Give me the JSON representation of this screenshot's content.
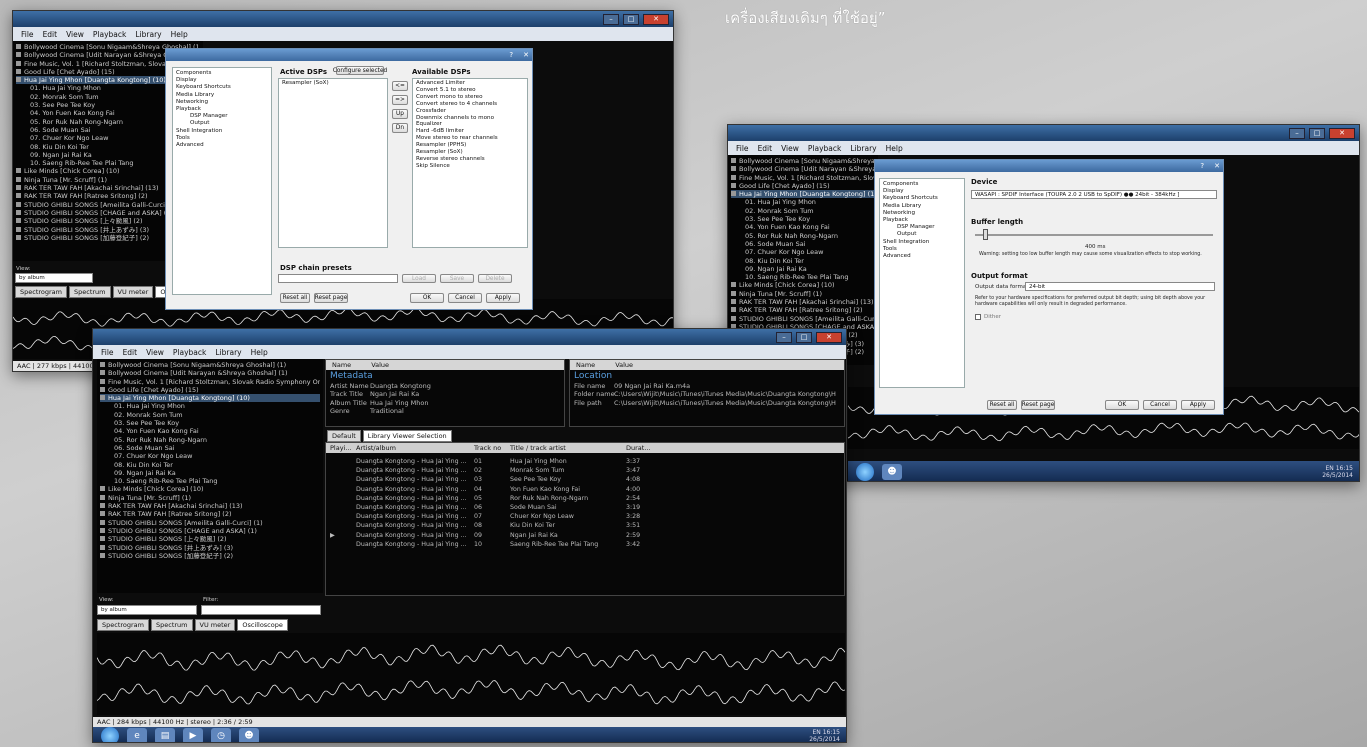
{
  "caption": "เครื่องเสียงเดิมๆ ที่ใช้อยู่”",
  "menu": [
    "File",
    "Edit",
    "View",
    "Playback",
    "Library",
    "Help"
  ],
  "library_tree": [
    {
      "label": "Bollywood Cinema [Sonu Nigaam&Shreya Ghoshal] (1)",
      "level": 0
    },
    {
      "label": "Bollywood Cinema [Udit Narayan &Shreya Ghoshal] (1)",
      "level": 0
    },
    {
      "label": "Fine Music, Vol. 1 [Richard Stoltzman, Slovak Radio Symphony Orche",
      "level": 0
    },
    {
      "label": "Good Life [Chet Ayado] (15)",
      "level": 0
    },
    {
      "label": "Hua Jai Ying Mhon [Duangta Kongtong] (10)",
      "level": 0,
      "selected": true
    },
    {
      "label": "01. Hua Jai Ying Mhon",
      "level": 1
    },
    {
      "label": "02. Monrak Som Tum",
      "level": 1
    },
    {
      "label": "03. See Pee Tee Koy",
      "level": 1
    },
    {
      "label": "04. Yon Fuen Kao Kong Fai",
      "level": 1
    },
    {
      "label": "05. Ror Ruk Nah Rong-Ngarn",
      "level": 1
    },
    {
      "label": "06. Sode Muan Sai",
      "level": 1
    },
    {
      "label": "07. Chuer Kor Ngo Leaw",
      "level": 1
    },
    {
      "label": "08. Kiu Din Koi Ter",
      "level": 1
    },
    {
      "label": "09. Ngan Jai Rai Ka",
      "level": 1
    },
    {
      "label": "10. Saeng Rib-Ree Tee Plai Tang",
      "level": 1
    },
    {
      "label": "Like Minds [Chick Corea] (10)",
      "level": 0
    },
    {
      "label": "Ninja Tuna [Mr. Scruff] (1)",
      "level": 0
    },
    {
      "label": "RAK TER TAW FAH [Akachai Srinchai] (13)",
      "level": 0
    },
    {
      "label": "RAK TER TAW FAH [Ratree Sritong] (2)",
      "level": 0
    },
    {
      "label": "STUDIO GHIBLI SONGS [Ameilita Galli-Curci] (1)",
      "level": 0
    },
    {
      "label": "STUDIO GHIBLI SONGS [CHAGE and ASKA] (1)",
      "level": 0
    },
    {
      "label": "STUDIO GHIBLI SONGS [上々颱風] (2)",
      "level": 0
    },
    {
      "label": "STUDIO GHIBLI SONGS [井上あずみ] (3)",
      "level": 0
    },
    {
      "label": "STUDIO GHIBLI SONGS [加藤登紀子] (2)",
      "level": 0
    }
  ],
  "view": {
    "label": "View:",
    "filter_label": "Filter:",
    "selected": "by album"
  },
  "vis_tabs": [
    {
      "label": "Spectrogram",
      "active": false
    },
    {
      "label": "Spectrum",
      "active": false
    },
    {
      "label": "VU meter",
      "active": false
    },
    {
      "label": "Oscilloscope",
      "active": true
    }
  ],
  "props_header": {
    "name": "Name",
    "value": "Value"
  },
  "metadata": {
    "heading": "Metadata",
    "rows": [
      [
        "Artist Name",
        "Duangta Kongtong"
      ],
      [
        "Track Title",
        "Ngan Jai Rai Ka"
      ],
      [
        "Album Title",
        "Hua Jai Ying Mhon"
      ],
      [
        "Genre",
        "Traditional"
      ]
    ]
  },
  "location": {
    "heading": "Location",
    "rows": [
      [
        "File name",
        "09 Ngan Jai Rai Ka.m4a"
      ],
      [
        "Folder name",
        "C:\\Users\\Wijit\\Music\\iTunes\\iTunes Media\\Music\\Duangta Kongtong\\H"
      ],
      [
        "File path",
        "C:\\Users\\Wijit\\Music\\iTunes\\iTunes Media\\Music\\Duangta Kongtong\\H"
      ]
    ]
  },
  "playlist_tabs": [
    {
      "label": "Default",
      "active": false
    },
    {
      "label": "Library Viewer Selection",
      "active": true
    }
  ],
  "playlist_cols": [
    "Playi...",
    "Artist/album",
    "Track no",
    "Title / track artist",
    "Durat..."
  ],
  "playlist_rows": [
    {
      "artist": "Duangta Kongtong - Hua Jai Ying ...",
      "no": "01",
      "title": "Hua Jai Ying Mhon",
      "dur": "3:37",
      "playing": ""
    },
    {
      "artist": "Duangta Kongtong - Hua Jai Ying ...",
      "no": "02",
      "title": "Monrak Som Tum",
      "dur": "3:47",
      "playing": ""
    },
    {
      "artist": "Duangta Kongtong - Hua Jai Ying ...",
      "no": "03",
      "title": "See Pee Tee Koy",
      "dur": "4:08",
      "playing": ""
    },
    {
      "artist": "Duangta Kongtong - Hua Jai Ying ...",
      "no": "04",
      "title": "Yon Fuen Kao Kong Fai",
      "dur": "4:00",
      "playing": ""
    },
    {
      "artist": "Duangta Kongtong - Hua Jai Ying ...",
      "no": "05",
      "title": "Ror Ruk Nah Rong-Ngarn",
      "dur": "2:54",
      "playing": ""
    },
    {
      "artist": "Duangta Kongtong - Hua Jai Ying ...",
      "no": "06",
      "title": "Sode Muan Sai",
      "dur": "3:19",
      "playing": ""
    },
    {
      "artist": "Duangta Kongtong - Hua Jai Ying ...",
      "no": "07",
      "title": "Chuer Kor Ngo Leaw",
      "dur": "3:28",
      "playing": ""
    },
    {
      "artist": "Duangta Kongtong - Hua Jai Ying ...",
      "no": "08",
      "title": "Kiu Din Koi Ter",
      "dur": "3:51",
      "playing": ""
    },
    {
      "artist": "Duangta Kongtong - Hua Jai Ying ...",
      "no": "09",
      "title": "Ngan Jai Rai Ka",
      "dur": "2:59",
      "playing": "▶"
    },
    {
      "artist": "Duangta Kongtong - Hua Jai Ying ...",
      "no": "10",
      "title": "Saeng Rib-Ree Tee Plai Tang",
      "dur": "3:42",
      "playing": ""
    }
  ],
  "status_main": "AAC | 284 kbps | 44100 Hz | stereo | 2:36 / 2:59",
  "status_back": "AAC | 277 kbps | 44100 Hz | stereo",
  "tray": {
    "lang": "EN",
    "time": "16:15",
    "date": "26/5/2014"
  },
  "dsp_dialog": {
    "tree": [
      {
        "label": "Components",
        "level": 0
      },
      {
        "label": "Display",
        "level": 0
      },
      {
        "label": "Keyboard Shortcuts",
        "level": 0
      },
      {
        "label": "Media Library",
        "level": 0
      },
      {
        "label": "Networking",
        "level": 0
      },
      {
        "label": "Playback",
        "level": 0
      },
      {
        "label": "DSP Manager",
        "level": 2
      },
      {
        "label": "Output",
        "level": 2
      },
      {
        "label": "Shell Integration",
        "level": 0
      },
      {
        "label": "Tools",
        "level": 0
      },
      {
        "label": "Advanced",
        "level": 0
      }
    ],
    "active_label": "Active DSPs",
    "configure_label": "Configure selected",
    "available_label": "Available DSPs",
    "active": [
      "Resampler (SoX)"
    ],
    "available": [
      "Advanced Limiter",
      "Convert 5.1 to stereo",
      "Convert mono to stereo",
      "Convert stereo to 4 channels",
      "Crossfader",
      "Downmix channels to mono",
      "Equalizer",
      "Hard -6dB limiter",
      "Move stereo to rear channels",
      "Resampler (PPHS)",
      "Resampler (SoX)",
      "Reverse stereo channels",
      "Skip Silence"
    ],
    "presets_label": "DSP chain presets",
    "load": "Load",
    "save": "Save",
    "delete": "Delete",
    "reset_all": "Reset all",
    "reset_page": "Reset page",
    "ok": "OK",
    "cancel": "Cancel",
    "apply": "Apply"
  },
  "output_dialog": {
    "device_label": "Device",
    "device_value": "WASAPI : SPDIF Interface (TOUPA 2.0 2 USB to SpDIF) ●● 24bit - 384kHz ]",
    "buffer_label": "Buffer length",
    "buffer_value": "400 ms",
    "buffer_warning": "Warning: setting too low buffer length may cause some visualization effects to stop working.",
    "format_label": "Output format",
    "format_field": "Output data format:",
    "format_value": "24-bit",
    "format_note": "Refer to your hardware specifications for preferred output bit depth; using bit depth above your hardware capabilities will only result in degraded performance.",
    "dither": "Dither",
    "reset_all": "Reset all",
    "reset_page": "Reset page",
    "ok": "OK",
    "cancel": "Cancel",
    "apply": "Apply"
  }
}
